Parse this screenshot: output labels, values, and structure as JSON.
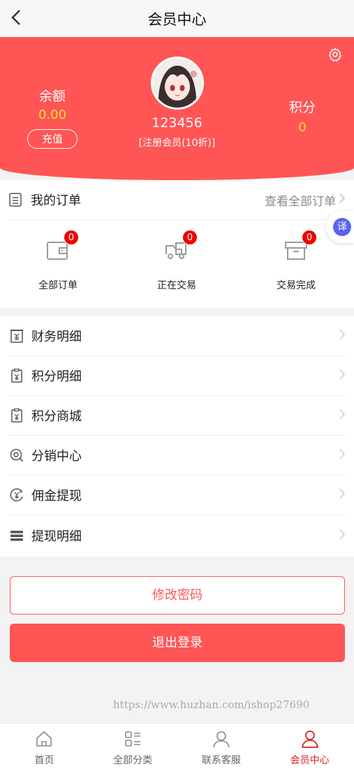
{
  "header": {
    "title": "会员中心"
  },
  "profile": {
    "balance_label": "余额",
    "balance_value": "0.00",
    "recharge_label": "充值",
    "username": "123456",
    "level": "[注册会员(10折)]",
    "points_label": "积分",
    "points_value": "0"
  },
  "orders": {
    "title": "我的订单",
    "view_all": "查看全部订单",
    "stats": [
      {
        "label": "全部订单",
        "count": "0",
        "icon": "wallet-icon"
      },
      {
        "label": "正在交易",
        "count": "0",
        "icon": "truck-icon"
      },
      {
        "label": "交易完成",
        "count": "0",
        "icon": "box-icon"
      }
    ]
  },
  "translate_button": {
    "label": "译"
  },
  "menu": [
    {
      "label": "财务明细",
      "icon": "finance-icon"
    },
    {
      "label": "积分明细",
      "icon": "points-detail-icon"
    },
    {
      "label": "积分商城",
      "icon": "points-mall-icon"
    },
    {
      "label": "分销中心",
      "icon": "distribution-icon"
    },
    {
      "label": "佣金提现",
      "icon": "commission-icon"
    },
    {
      "label": "提现明细",
      "icon": "withdraw-list-icon"
    }
  ],
  "buttons": {
    "change_password": "修改密码",
    "logout": "退出登录"
  },
  "watermark": "https://www.huzhan.com/ishop27690",
  "tabbar": [
    {
      "label": "首页",
      "icon": "home-icon"
    },
    {
      "label": "全部分类",
      "icon": "category-icon"
    },
    {
      "label": "联系客服",
      "icon": "service-icon"
    },
    {
      "label": "会员中心",
      "icon": "member-icon",
      "active": true
    }
  ],
  "colors": {
    "brand": "#ff5555",
    "highlight": "#ffe033",
    "badge": "#ee0000",
    "tab_active": "#e02020"
  }
}
